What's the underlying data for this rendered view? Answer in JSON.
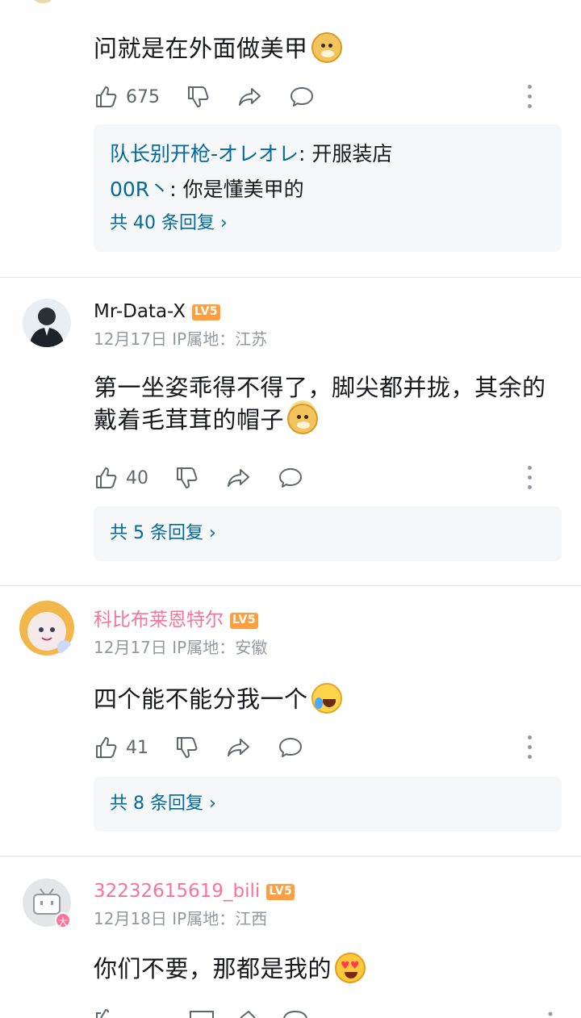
{
  "colors": {
    "link": "#00699d",
    "pink_name": "#fb7299",
    "level_badge": "#ff9e3e",
    "muted": "#9499a0",
    "reply_bg": "#f6f7f8"
  },
  "comment0": {
    "text": "问就是在外面做美甲",
    "emoji": "doge-emoji",
    "likes": "675",
    "replies": [
      {
        "user": "队长别开枪-オレオレ",
        "sep": ": ",
        "text": "开服装店"
      },
      {
        "user": "00R丶",
        "sep": ": ",
        "text": "你是懂美甲的"
      }
    ],
    "more": "共 40 条回复 ›"
  },
  "comment1": {
    "username": "Mr-Data-X",
    "level": "LV5",
    "date": "12月17日",
    "ip": "IP属地：江苏",
    "text_line1": "第一坐姿乖得不得了，脚尖都并拢，其余的",
    "text_line2": "戴着毛茸茸的帽子",
    "emoji": "doge-halo-emoji",
    "likes": "40",
    "more": "共 5 条回复 ›"
  },
  "comment2": {
    "username": "科比布莱恩特尔",
    "level": "LV5",
    "date": "12月17日",
    "ip": "IP属地：安徽",
    "text": "四个能不能分我一个",
    "emoji": "laugh-cry-emoji",
    "likes": "41",
    "more": "共 8 条回复 ›"
  },
  "comment3": {
    "username": "32232615619_bili",
    "level": "LV5",
    "date": "12月18日",
    "ip": "IP属地：江西",
    "text": "你们不要，那都是我的",
    "emoji": "heart-eyes-emoji"
  }
}
